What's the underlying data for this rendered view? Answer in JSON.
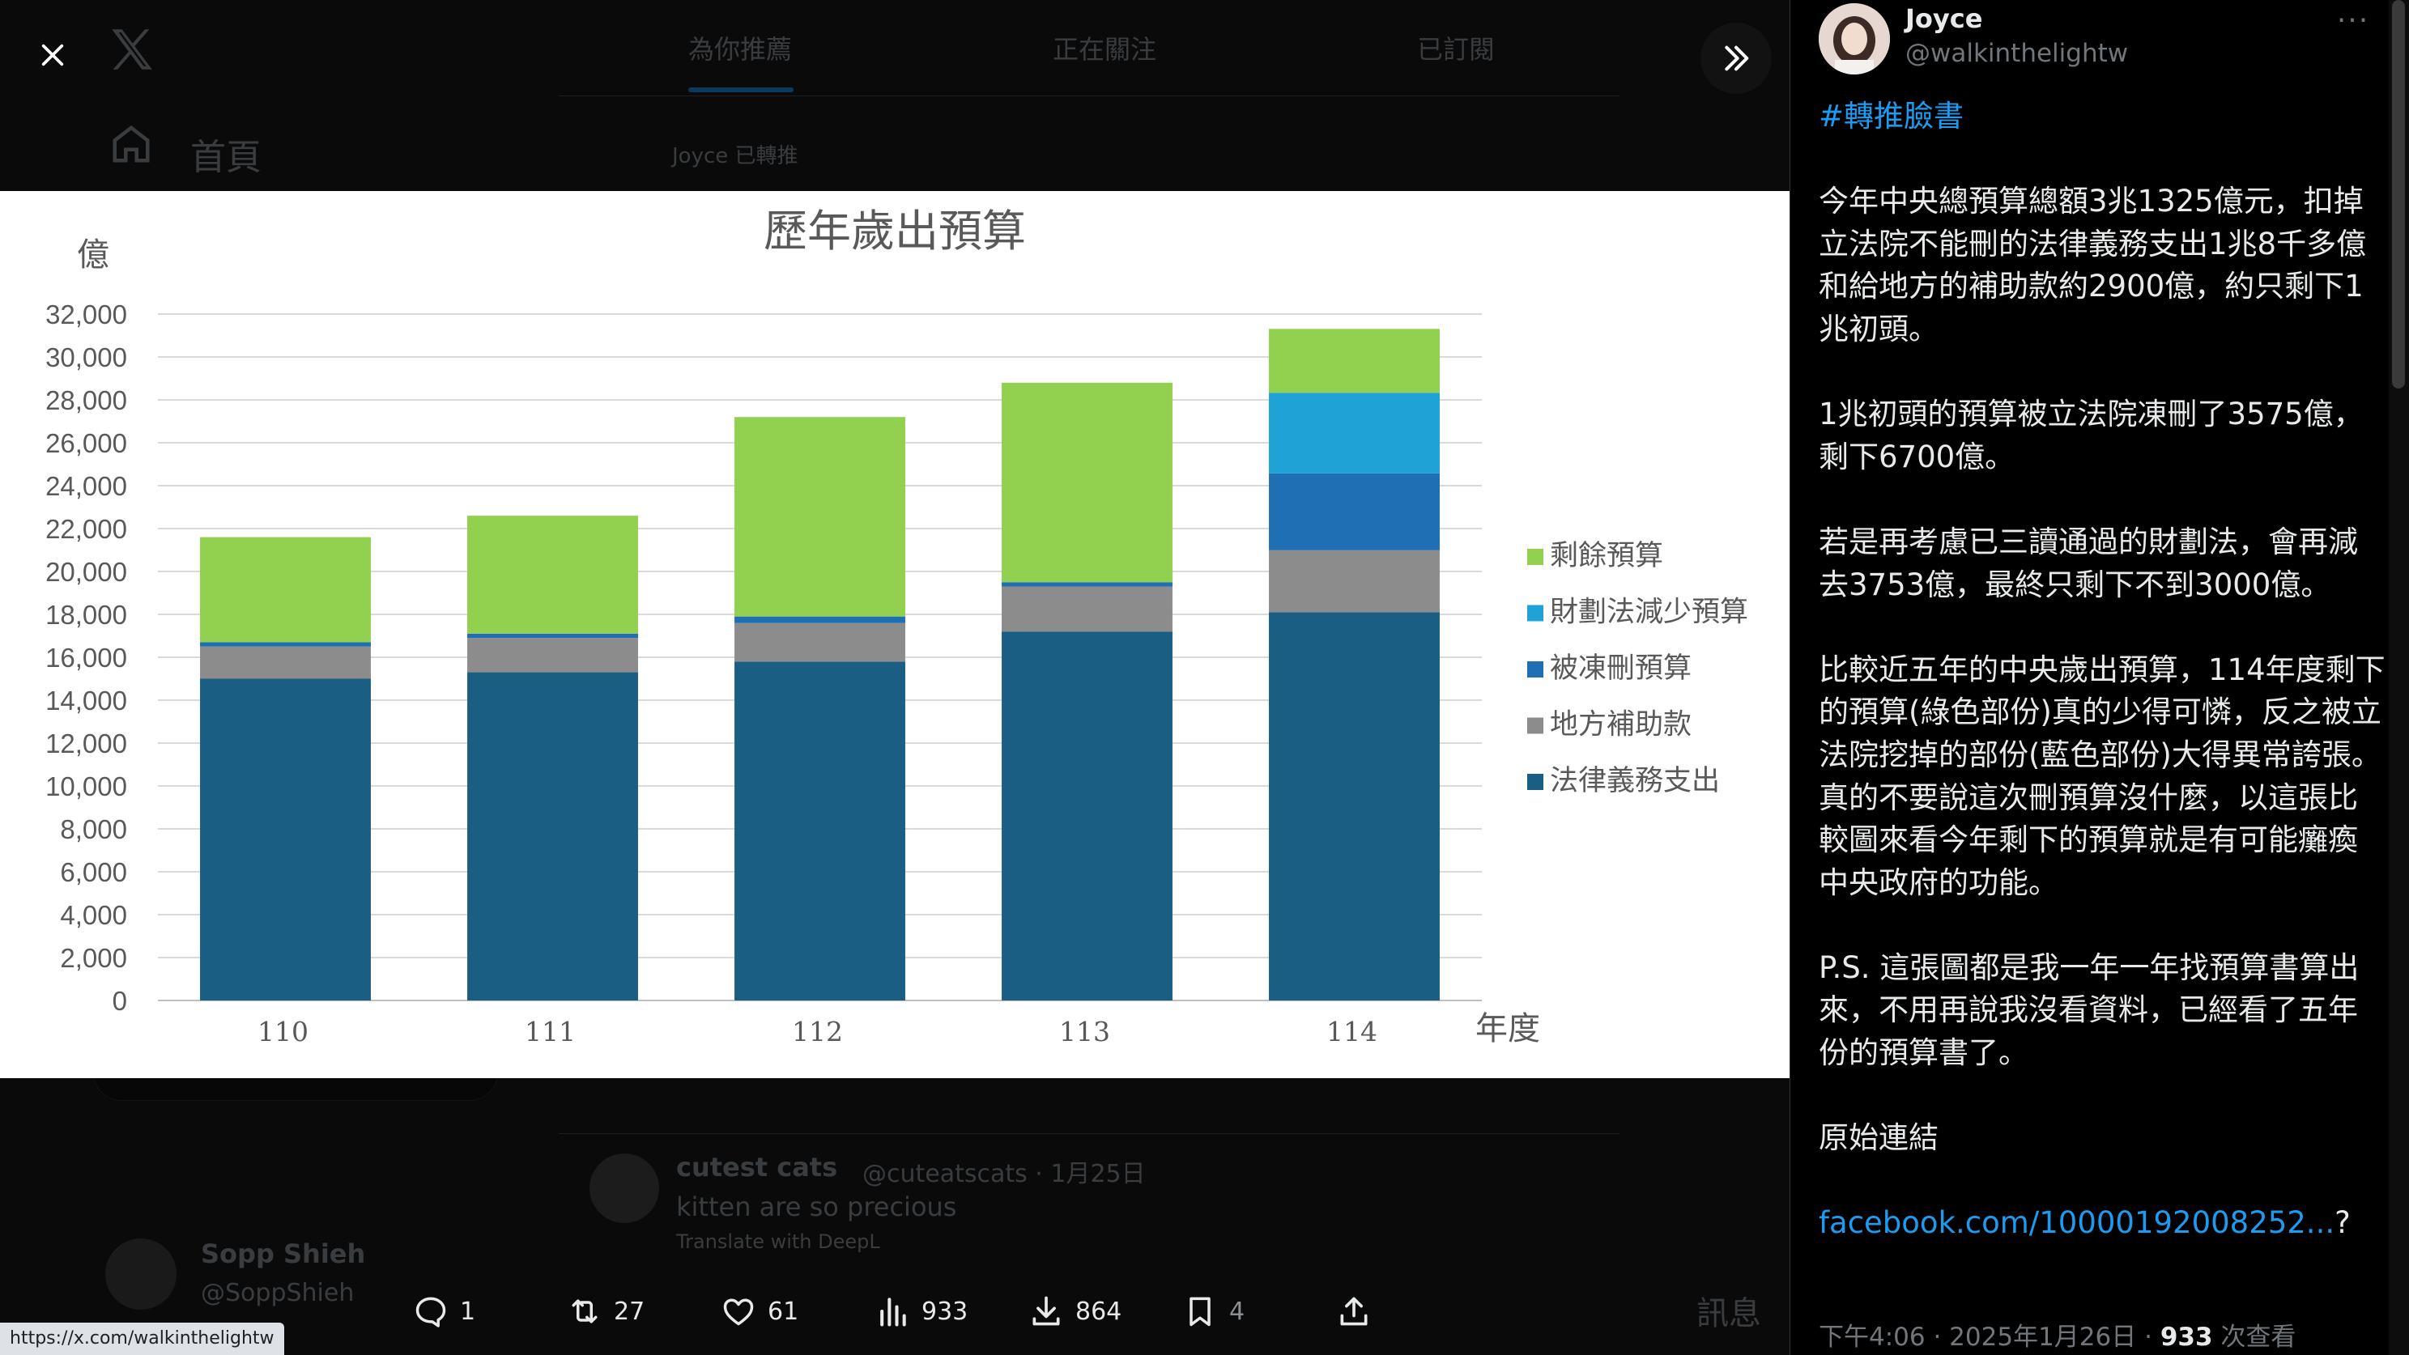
{
  "background": {
    "home_label": "首頁",
    "tab_for_you": "為你推薦",
    "tab_following": "正在關注",
    "tab_subscribed": "已訂閱",
    "retweet_note": "Joyce 已轉推",
    "bg_post_name": "cutest cats",
    "bg_post_handle": "@cuteatscats · 1月25日",
    "bg_post_text": "kitten are so precious",
    "bg_post_translate": "Translate with DeepL",
    "user_name": "Sopp Shieh",
    "user_handle": "@SoppShieh",
    "side_label": "訊息"
  },
  "chart_data": {
    "type": "bar",
    "stacked": true,
    "title": "歷年歲出預算",
    "ylabel": "億",
    "xlabel": "年度",
    "categories": [
      "110",
      "111",
      "112",
      "113",
      "114"
    ],
    "ylim": [
      0,
      32000
    ],
    "yticks": [
      "0",
      "2,000",
      "4,000",
      "6,000",
      "8,000",
      "10,000",
      "12,000",
      "14,000",
      "16,000",
      "18,000",
      "20,000",
      "22,000",
      "24,000",
      "26,000",
      "28,000",
      "30,000",
      "32,000"
    ],
    "grid": true,
    "legend_position": "right",
    "series": [
      {
        "name": "法律義務支出",
        "color": "#1b5e83",
        "values": [
          15000,
          15300,
          15800,
          17200,
          18100
        ]
      },
      {
        "name": "地方補助款",
        "color": "#8c8c8c",
        "values": [
          1500,
          1600,
          1800,
          2100,
          2900
        ]
      },
      {
        "name": "被凍刪預算",
        "color": "#1f6fb5",
        "values": [
          200,
          200,
          300,
          200,
          3575
        ]
      },
      {
        "name": "財劃法減少預算",
        "color": "#1fa2d6",
        "values": [
          0,
          0,
          0,
          0,
          3753
        ]
      },
      {
        "name": "剩餘預算",
        "color": "#92d050",
        "values": [
          4900,
          5500,
          9300,
          9300,
          2980
        ]
      }
    ]
  },
  "actions": {
    "reply_count": "1",
    "repost_count": "27",
    "like_count": "61",
    "views_count": "933",
    "download_count": "864",
    "bookmark_count": "4"
  },
  "status_url": "https://x.com/walkinthelightw",
  "post": {
    "author_name": "Joyce",
    "author_handle": "@walkinthelightw",
    "more_label": "···",
    "hashtag": "#轉推臉書",
    "paragraphs": [
      "今年中央總預算總額3兆1325億元，扣掉立法院不能刪的法律義務支出1兆8千多億和給地方的補助款約2900億，約只剩下1兆初頭。",
      "1兆初頭的預算被立法院凍刪了3575億，剩下6700億。",
      "若是再考慮已三讀通過的財劃法，會再減去3753億，最終只剩下不到3000億。",
      "比較近五年的中央歲出預算，114年度剩下的預算(綠色部份)真的少得可憐，反之被立法院挖掉的部份(藍色部份)大得異常誇張。真的不要說這次刪預算沒什麼，以這張比較圖來看今年剩下的預算就是有可能癱瘓中央政府的功能。",
      "P.S. 這張圖都是我一年一年找預算書算出來，不用再說我沒看資料，已經看了五年份的預算書了。",
      "原始連結"
    ],
    "link_text": "facebook.com/10000192008252...",
    "link_suffix": "?",
    "meta_time": "下午4:06 · 2025年1月26日 · ",
    "meta_views": "933",
    "meta_views_label": " 次查看"
  },
  "colors": {
    "accent": "#1d9bf0",
    "text": "#e7e9ea",
    "muted": "#71767b"
  }
}
